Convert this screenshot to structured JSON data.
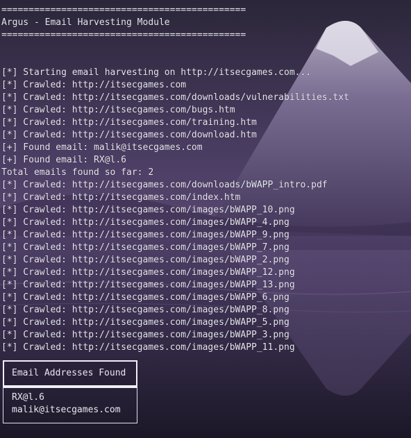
{
  "header": {
    "rule_top": "=============================================",
    "title": "Argus - Email Harvesting Module",
    "rule_bottom": "============================================="
  },
  "log": [
    "[*] Starting email harvesting on http://itsecgames.com...",
    "[*] Crawled: http://itsecgames.com",
    "[*] Crawled: http://itsecgames.com/downloads/vulnerabilities.txt",
    "[*] Crawled: http://itsecgames.com/bugs.htm",
    "[*] Crawled: http://itsecgames.com/training.htm",
    "[*] Crawled: http://itsecgames.com/download.htm",
    "[+] Found email: malik@itsecgames.com",
    "[+] Found email: RX@l.6",
    "Total emails found so far: 2",
    "[*] Crawled: http://itsecgames.com/downloads/bWAPP_intro.pdf",
    "[*] Crawled: http://itsecgames.com/index.htm",
    "[*] Crawled: http://itsecgames.com/images/bWAPP_10.png",
    "[*] Crawled: http://itsecgames.com/images/bWAPP_4.png",
    "[*] Crawled: http://itsecgames.com/images/bWAPP_9.png",
    "[*] Crawled: http://itsecgames.com/images/bWAPP_7.png",
    "[*] Crawled: http://itsecgames.com/images/bWAPP_2.png",
    "[*] Crawled: http://itsecgames.com/images/bWAPP_12.png",
    "[*] Crawled: http://itsecgames.com/images/bWAPP_13.png",
    "[*] Crawled: http://itsecgames.com/images/bWAPP_6.png",
    "[*] Crawled: http://itsecgames.com/images/bWAPP_8.png",
    "[*] Crawled: http://itsecgames.com/images/bWAPP_5.png",
    "[*] Crawled: http://itsecgames.com/images/bWAPP_3.png",
    "[*] Crawled: http://itsecgames.com/images/bWAPP_11.png"
  ],
  "results_panel": {
    "title": "Email Addresses Found",
    "emails": [
      "RX@l.6",
      "malik@itsecgames.com"
    ]
  },
  "colors": {
    "text": "#e9e6f0",
    "border": "#f2f0f7"
  }
}
